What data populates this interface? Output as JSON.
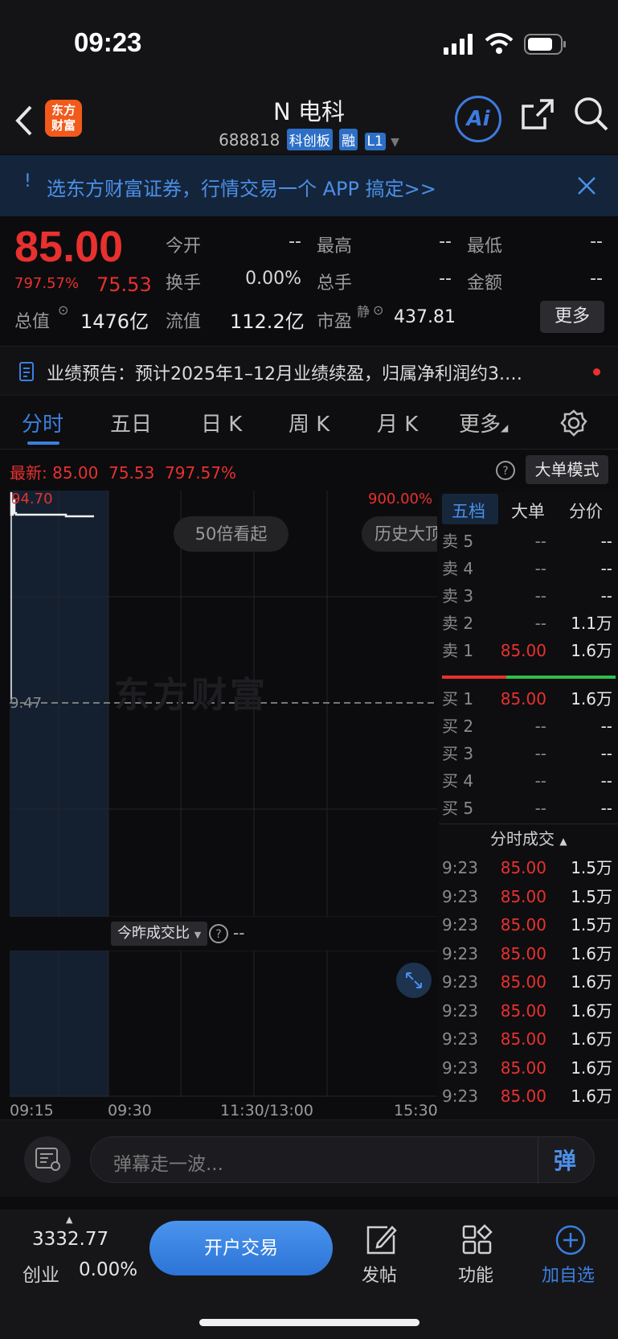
{
  "status": {
    "time": "09:23"
  },
  "header": {
    "logo_line1": "东方",
    "logo_line2": "财富",
    "title": "N 电科",
    "code": "688818",
    "tags": [
      "科创板",
      "融",
      "L1"
    ],
    "ai_label": "Ai"
  },
  "banner": {
    "text": "选东方财富证券，行情交易一个 APP 搞定>>"
  },
  "quote": {
    "price": "85.00",
    "change_pct": "797.57%",
    "change_amt": "75.53",
    "fields": [
      {
        "label": "今开",
        "value": "--"
      },
      {
        "label": "最高",
        "value": "--"
      },
      {
        "label": "最低",
        "value": "--"
      },
      {
        "label": "换手",
        "value": "0.00%"
      },
      {
        "label": "总手",
        "value": "--"
      },
      {
        "label": "金额",
        "value": "--"
      }
    ],
    "total_mv_label": "总值",
    "total_mv": "1476亿",
    "float_mv_label": "流值",
    "float_mv": "112.2亿",
    "pe_label": "市盈",
    "pe_sup": "静",
    "pe": "437.81",
    "more_label": "更多"
  },
  "notice": {
    "text": "业绩预告：预计2025年1–12月业绩续盈，归属净利润约3.…"
  },
  "tabs": [
    "分时",
    "五日",
    "日 K",
    "周 K",
    "月 K",
    "更多"
  ],
  "chart": {
    "latest_prefix": "最新:",
    "latest_price": "85.00",
    "latest_amt": "75.53",
    "latest_pct": "797.57%",
    "big_order_mode": "大单模式",
    "y_high": "94.70",
    "y_mid": "9.47",
    "pct_high": "900.00%",
    "badge_50x": "50倍看起",
    "badge_history": "历史大顶",
    "watermark": "东方财富",
    "vol_selector": "今昨成交比",
    "vol_value": "--",
    "x_labels": [
      "09:15",
      "09:30",
      "11:30/13:00",
      "15:30"
    ]
  },
  "panel": {
    "tabs": [
      "五档",
      "大单",
      "分价"
    ],
    "sells": [
      {
        "label": "卖 5",
        "price": "--",
        "vol": "--"
      },
      {
        "label": "卖 4",
        "price": "--",
        "vol": "--"
      },
      {
        "label": "卖 3",
        "price": "--",
        "vol": "--"
      },
      {
        "label": "卖 2",
        "price": "--",
        "vol": "1.1万"
      },
      {
        "label": "卖 1",
        "price": "85.00",
        "vol": "1.6万"
      }
    ],
    "buys": [
      {
        "label": "买 1",
        "price": "85.00",
        "vol": "1.6万"
      },
      {
        "label": "买 2",
        "price": "--",
        "vol": "--"
      },
      {
        "label": "买 3",
        "price": "--",
        "vol": "--"
      },
      {
        "label": "买 4",
        "price": "--",
        "vol": "--"
      },
      {
        "label": "买 5",
        "price": "--",
        "vol": "--"
      }
    ],
    "ticks_title": "分时成交",
    "ticks": [
      {
        "time": "9:23",
        "price": "85.00",
        "vol": "1.5万"
      },
      {
        "time": "9:23",
        "price": "85.00",
        "vol": "1.5万"
      },
      {
        "time": "9:23",
        "price": "85.00",
        "vol": "1.5万"
      },
      {
        "time": "9:23",
        "price": "85.00",
        "vol": "1.6万"
      },
      {
        "time": "9:23",
        "price": "85.00",
        "vol": "1.6万"
      },
      {
        "time": "9:23",
        "price": "85.00",
        "vol": "1.6万"
      },
      {
        "time": "9:23",
        "price": "85.00",
        "vol": "1.6万"
      },
      {
        "time": "9:23",
        "price": "85.00",
        "vol": "1.6万"
      },
      {
        "time": "9:23",
        "price": "85.00",
        "vol": "1.6万"
      }
    ]
  },
  "comment": {
    "placeholder": "弹幕走一波...",
    "danmu_label": "弹"
  },
  "bottom": {
    "index_value": "3332.77",
    "index_name": "创业",
    "index_pct": "0.00%",
    "trade_label": "开户交易",
    "nav": [
      "发帖",
      "功能",
      "加自选"
    ]
  },
  "colors": {
    "up": "#e8312f",
    "down": "#2fbf4a",
    "accent": "#3b7fe0",
    "brand": "#f25a1c"
  }
}
